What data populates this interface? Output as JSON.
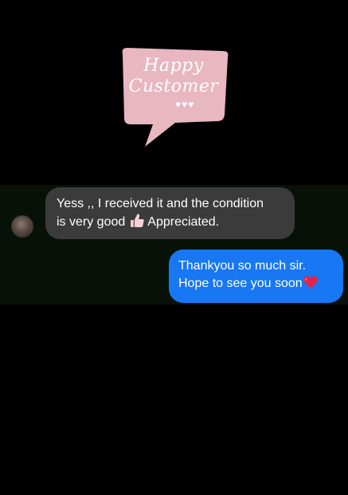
{
  "sticker": {
    "line1": "Happy",
    "line2": "Customer",
    "hearts": "♥♥♥",
    "color": "#e8b7c0"
  },
  "chat": {
    "incoming": {
      "line1": "Yess ,, I received it and the condition",
      "line2_before": "is very good",
      "line2_emoji": "thumbs-up",
      "line2_after": "Appreciated."
    },
    "outgoing": {
      "line1": "Thankyou so much sir.",
      "line2": "Hope to see you soon",
      "line2_emoji": "red-heart"
    }
  },
  "colors": {
    "background": "#000000",
    "chat_band": "#081108",
    "incoming_bubble": "#3b3b3b",
    "outgoing_bubble": "#1877f2"
  }
}
